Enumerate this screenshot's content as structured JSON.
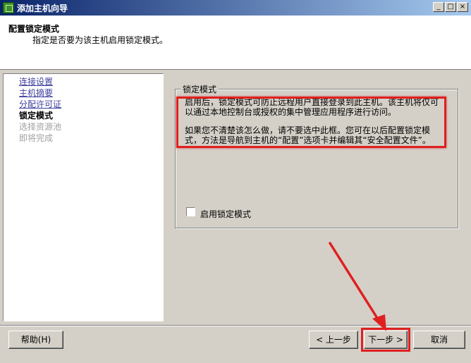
{
  "window": {
    "title": "添加主机向导",
    "controls": {
      "minimize": "_",
      "maximize": "□",
      "close": "×"
    }
  },
  "header": {
    "title": "配置锁定模式",
    "subtitle": "指定是否要为该主机启用锁定模式。"
  },
  "nav": {
    "items": [
      {
        "label": "连接设置",
        "state": "link"
      },
      {
        "label": "主机摘要",
        "state": "link"
      },
      {
        "label": "分配许可证",
        "state": "link"
      },
      {
        "label": "锁定模式",
        "state": "current"
      },
      {
        "label": "选择资源池",
        "state": "disabled"
      },
      {
        "label": "即将完成",
        "state": "disabled"
      }
    ]
  },
  "group": {
    "legend": "锁定模式",
    "para1_line1": "启用后，锁定模式可防止远程用户直接登录到此主机。该主机将仅可",
    "para1_line2": "以通过本地控制台或授权的集中管理应用程序进行访问。",
    "para2_line1": "如果您不清楚该怎么做，请不要选中此框。您可在以后配置锁定模",
    "para2_line2": "式，方法是导航到主机的“配置”选项卡并编辑其“安全配置文件”。",
    "checkbox_label": "启用锁定模式",
    "checkbox_checked": false
  },
  "buttons": {
    "help": "帮助(H)",
    "back": "< 上一步",
    "next": "下一步 >",
    "cancel": "取消"
  },
  "colors": {
    "titlebar_start": "#0a246a",
    "titlebar_end": "#a6caf0",
    "link": "#4040a0",
    "disabled": "#a0a0a0",
    "annotation": "#e02020"
  }
}
